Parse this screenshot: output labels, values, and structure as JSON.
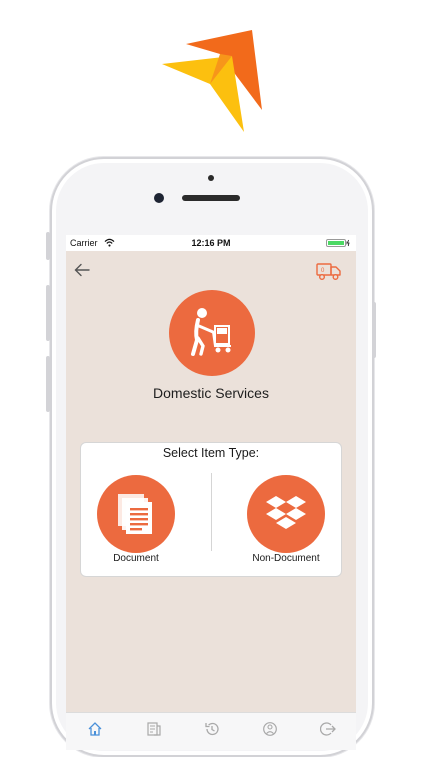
{
  "status_bar": {
    "carrier": "Carrier",
    "time": "12:16 PM"
  },
  "header": {
    "back_icon": "back-arrow-icon",
    "right_icon": "delivery-truck-icon"
  },
  "service": {
    "icon": "person-pushing-cart-icon",
    "title": "Domestic Services"
  },
  "item_type_card": {
    "title": "Select Item Type:",
    "options": [
      {
        "label": "Document",
        "icon": "document-pages-icon"
      },
      {
        "label": "Non-Document",
        "icon": "dropbox-box-icon"
      }
    ]
  },
  "tab_bar": {
    "items": [
      {
        "icon": "home-icon",
        "active": true
      },
      {
        "icon": "tracking-icon",
        "active": false
      },
      {
        "icon": "history-icon",
        "active": false
      },
      {
        "icon": "support-icon",
        "active": false
      },
      {
        "icon": "logout-icon",
        "active": false
      }
    ]
  },
  "colors": {
    "accent": "#ec6a3f",
    "screen_background": "#ebe1da",
    "active_tab": "#4a90d9",
    "inactive_tab": "#a9a9a9"
  }
}
